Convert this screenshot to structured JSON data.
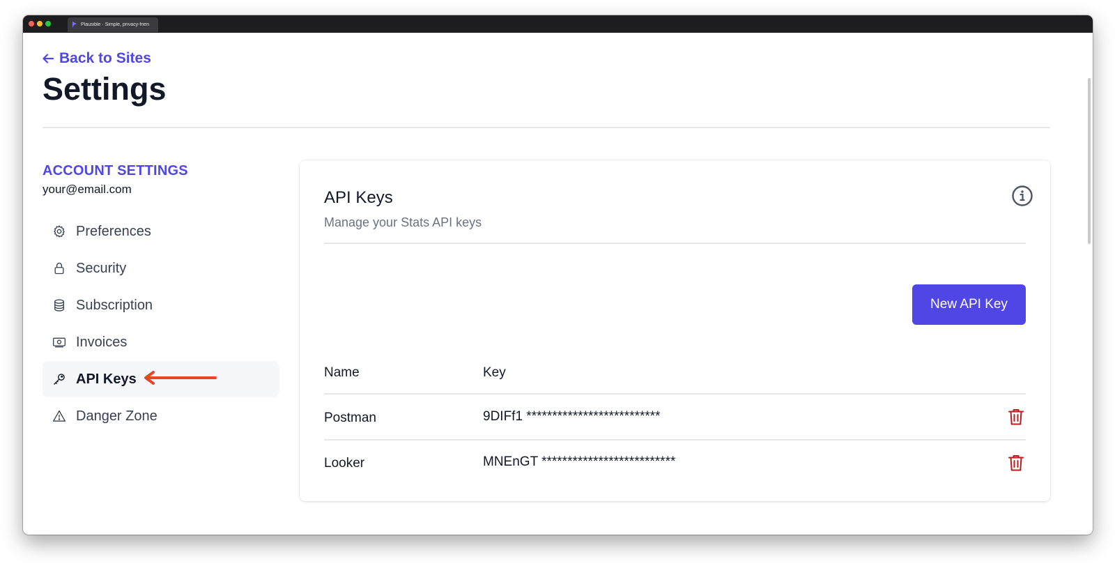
{
  "browser": {
    "tab_title": "Plausible · Simple, privacy-frien"
  },
  "header": {
    "back_label": "Back to Sites",
    "page_title": "Settings"
  },
  "sidebar": {
    "heading": "ACCOUNT SETTINGS",
    "email": "your@email.com",
    "items": [
      {
        "label": "Preferences",
        "icon": "gear-icon"
      },
      {
        "label": "Security",
        "icon": "lock-icon"
      },
      {
        "label": "Subscription",
        "icon": "database-icon"
      },
      {
        "label": "Invoices",
        "icon": "banknote-icon"
      },
      {
        "label": "API Keys",
        "icon": "key-icon",
        "active": true
      },
      {
        "label": "Danger Zone",
        "icon": "warning-icon"
      }
    ]
  },
  "card": {
    "title": "API Keys",
    "subtitle": "Manage your Stats API keys",
    "new_key_label": "New API Key",
    "columns": [
      "Name",
      "Key"
    ],
    "rows": [
      {
        "name": "Postman",
        "key": "9DIFf1 **************************"
      },
      {
        "name": "Looker",
        "key": "MNEnGT **************************"
      }
    ]
  },
  "colors": {
    "accent": "#4f46e5",
    "annotation_arrow": "#e8442a",
    "delete_icon": "#b91c1c"
  }
}
